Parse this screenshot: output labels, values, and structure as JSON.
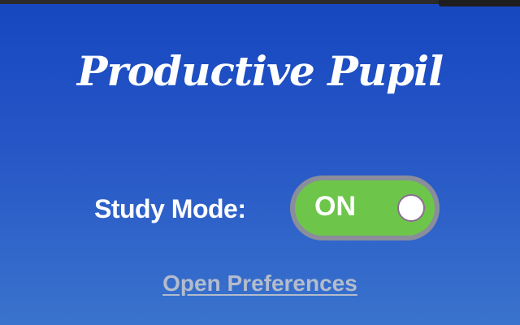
{
  "app": {
    "title": "Productive Pupil"
  },
  "study_mode": {
    "label": "Study Mode:",
    "state_text": "ON",
    "enabled": true,
    "on_color": "#6dc64a"
  },
  "links": {
    "preferences": "Open Preferences"
  },
  "colors": {
    "background_top": "#1647c0",
    "background_bottom": "#3a73cd",
    "link_color": "#b3bccd"
  }
}
